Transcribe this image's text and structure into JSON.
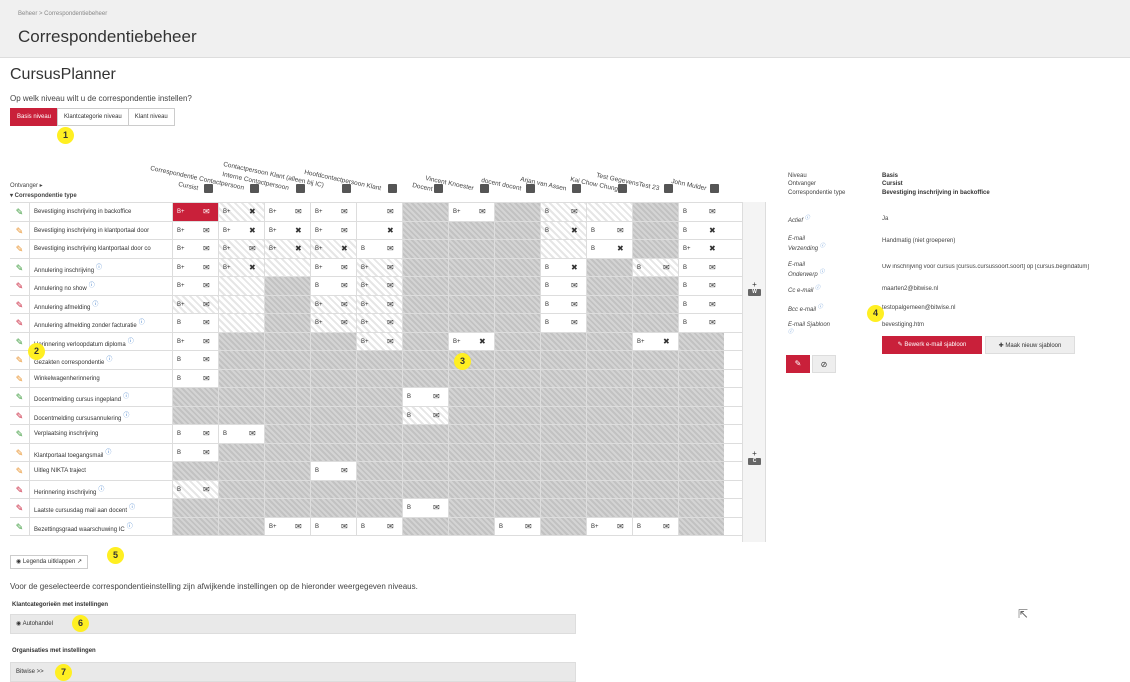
{
  "breadcrumb": "Beheer > Correspondentiebeheer",
  "page_title": "Correspondentiebeheer",
  "app_title": "CursusPlanner",
  "question": "Op welk niveau wilt u de correspondentie instellen?",
  "tabs": [
    "Basis niveau",
    "Klantcategorie niveau",
    "Klant niveau"
  ],
  "columns": [
    "Cursist",
    "Correspondentie Contactpersoon",
    "Interne Contactpersoon",
    "Contactpersoon Klant (alleen bij IC)",
    "Hoofdcontactpersoon Klant",
    "Docent",
    "Vincent Knoester",
    "docent docent",
    "Arjan van Assen",
    "Kai Chow Chung",
    "Test GegevensTest 23",
    "John Mulder"
  ],
  "ontvanger_label": "Ontvanger ▸",
  "correspondentie_type_label": "▾ Correspondentie type",
  "rows": [
    {
      "name": "Bevestiging inschrijving in backoffice",
      "status": "g",
      "info": false
    },
    {
      "name": "Bevestiging inschrijving in klantportaal door",
      "status": "o",
      "info": false
    },
    {
      "name": "Bevestiging inschrijving klantportaal door co",
      "status": "o",
      "info": false
    },
    {
      "name": "Annulering inschrijving",
      "status": "g",
      "info": true
    },
    {
      "name": "Annulering no show",
      "status": "r",
      "info": true
    },
    {
      "name": "Annulering afmelding",
      "status": "r",
      "info": true
    },
    {
      "name": "Annulering afmelding zonder facturatie",
      "status": "r",
      "info": true
    },
    {
      "name": "Herinnering verloopdatum diploma",
      "status": "g",
      "info": true
    },
    {
      "name": "Gezakten correspondentie",
      "status": "o",
      "info": true
    },
    {
      "name": "Winkelwagenherinnering",
      "status": "o",
      "info": false
    },
    {
      "name": "Docentmelding cursus ingepland",
      "status": "g",
      "info": true
    },
    {
      "name": "Docentmelding cursusannulering",
      "status": "r",
      "info": true
    },
    {
      "name": "Verplaatsing inschrijving",
      "status": "g",
      "info": false
    },
    {
      "name": "Klantportaal toegangsmail",
      "status": "o",
      "info": true
    },
    {
      "name": "Uitleg NIKTA traject",
      "status": "o",
      "info": false
    },
    {
      "name": "Herinnering inschrijving",
      "status": "r",
      "info": true
    },
    {
      "name": "Laatste cursusdag mail aan docent",
      "status": "r",
      "info": true
    },
    {
      "name": "Bezettingsgraad waarschuwing IC",
      "status": "g",
      "info": true
    }
  ],
  "cells": [
    [
      [
        "sel",
        "B+",
        "✉"
      ],
      [
        "hat",
        "B+",
        "✖"
      ],
      [
        "on",
        "B+",
        "✉"
      ],
      [
        "on",
        "B+",
        "✉"
      ],
      [
        "on",
        "",
        "✉"
      ],
      [
        "na",
        "",
        ""
      ],
      [
        "on",
        "B+",
        "✉"
      ],
      [
        "na",
        "",
        ""
      ],
      [
        "hat",
        "B",
        "✉"
      ],
      [
        "hat",
        "",
        ""
      ],
      [
        "na",
        "",
        ""
      ],
      [
        "on",
        "B",
        "✉"
      ]
    ],
    [
      [
        "on",
        "B+",
        "✉"
      ],
      [
        "on",
        "B+",
        "✖"
      ],
      [
        "on",
        "B+",
        "✖"
      ],
      [
        "on",
        "B+",
        "✉"
      ],
      [
        "on",
        "",
        "✖"
      ],
      [
        "na",
        "",
        ""
      ],
      [
        "na",
        "",
        ""
      ],
      [
        "na",
        "",
        ""
      ],
      [
        "hat",
        "B",
        "✖"
      ],
      [
        "on",
        "B",
        "✉"
      ],
      [
        "na",
        "",
        ""
      ],
      [
        "on",
        "B",
        "✖"
      ]
    ],
    [
      [
        "on",
        "B+",
        "✉"
      ],
      [
        "hat",
        "B+",
        "✉"
      ],
      [
        "hat",
        "B+",
        "✖"
      ],
      [
        "hat",
        "B+",
        "✖"
      ],
      [
        "on",
        "B",
        "✉"
      ],
      [
        "na",
        "",
        ""
      ],
      [
        "na",
        "",
        ""
      ],
      [
        "na",
        "",
        ""
      ],
      [
        "hat",
        "",
        ""
      ],
      [
        "on",
        "B",
        "✖"
      ],
      [
        "na",
        "",
        ""
      ],
      [
        "on",
        "B+",
        "✖"
      ]
    ],
    [
      [
        "on",
        "B+",
        "✉"
      ],
      [
        "hat",
        "B+",
        "✖"
      ],
      [
        "hat",
        "",
        ""
      ],
      [
        "on",
        "B+",
        "✉"
      ],
      [
        "hat",
        "B+",
        "✉"
      ],
      [
        "na",
        "",
        ""
      ],
      [
        "na",
        "",
        ""
      ],
      [
        "na",
        "",
        ""
      ],
      [
        "on",
        "B",
        "✖"
      ],
      [
        "na",
        "",
        ""
      ],
      [
        "hat",
        "B",
        "✉"
      ],
      [
        "on",
        "B",
        "✉"
      ]
    ],
    [
      [
        "on",
        "B+",
        "✉"
      ],
      [
        "hat",
        "",
        ""
      ],
      [
        "na",
        "",
        ""
      ],
      [
        "on",
        "B",
        "✉"
      ],
      [
        "hat",
        "B+",
        "✉"
      ],
      [
        "na",
        "",
        ""
      ],
      [
        "na",
        "",
        ""
      ],
      [
        "na",
        "",
        ""
      ],
      [
        "on",
        "B",
        "✉"
      ],
      [
        "na",
        "",
        ""
      ],
      [
        "na",
        "",
        ""
      ],
      [
        "on",
        "B",
        "✉"
      ]
    ],
    [
      [
        "hat",
        "B+",
        "✉"
      ],
      [
        "hat",
        "",
        ""
      ],
      [
        "na",
        "",
        ""
      ],
      [
        "hat",
        "B+",
        "✉"
      ],
      [
        "hat",
        "B+",
        "✉"
      ],
      [
        "na",
        "",
        ""
      ],
      [
        "na",
        "",
        ""
      ],
      [
        "na",
        "",
        ""
      ],
      [
        "on",
        "B",
        "✉"
      ],
      [
        "na",
        "",
        ""
      ],
      [
        "na",
        "",
        ""
      ],
      [
        "on",
        "B",
        "✉"
      ]
    ],
    [
      [
        "on",
        "B",
        "✉"
      ],
      [
        "hat",
        "",
        ""
      ],
      [
        "na",
        "",
        ""
      ],
      [
        "hat",
        "B+",
        "✉"
      ],
      [
        "hat",
        "B+",
        "✉"
      ],
      [
        "na",
        "",
        ""
      ],
      [
        "na",
        "",
        ""
      ],
      [
        "na",
        "",
        ""
      ],
      [
        "on",
        "B",
        "✉"
      ],
      [
        "na",
        "",
        ""
      ],
      [
        "na",
        "",
        ""
      ],
      [
        "on",
        "B",
        "✉"
      ]
    ],
    [
      [
        "on",
        "B+",
        "✉"
      ],
      [
        "na",
        "",
        ""
      ],
      [
        "na",
        "",
        ""
      ],
      [
        "na",
        "",
        ""
      ],
      [
        "hat",
        "B+",
        "✉"
      ],
      [
        "na",
        "",
        ""
      ],
      [
        "on",
        "B+",
        "✖"
      ],
      [
        "na",
        "",
        ""
      ],
      [
        "na",
        "",
        ""
      ],
      [
        "na",
        "",
        ""
      ],
      [
        "on",
        "B+",
        "✖"
      ],
      [
        "na",
        "",
        ""
      ]
    ],
    [
      [
        "on",
        "B",
        "✉"
      ],
      [
        "na",
        "",
        ""
      ],
      [
        "na",
        "",
        ""
      ],
      [
        "na",
        "",
        ""
      ],
      [
        "na",
        "",
        ""
      ],
      [
        "na",
        "",
        ""
      ],
      [
        "na",
        "",
        ""
      ],
      [
        "na",
        "",
        ""
      ],
      [
        "na",
        "",
        ""
      ],
      [
        "na",
        "",
        ""
      ],
      [
        "na",
        "",
        ""
      ],
      [
        "na",
        "",
        ""
      ]
    ],
    [
      [
        "on",
        "B",
        "✉"
      ],
      [
        "na",
        "",
        ""
      ],
      [
        "na",
        "",
        ""
      ],
      [
        "na",
        "",
        ""
      ],
      [
        "na",
        "",
        ""
      ],
      [
        "na",
        "",
        ""
      ],
      [
        "na",
        "",
        ""
      ],
      [
        "na",
        "",
        ""
      ],
      [
        "na",
        "",
        ""
      ],
      [
        "na",
        "",
        ""
      ],
      [
        "na",
        "",
        ""
      ],
      [
        "na",
        "",
        ""
      ]
    ],
    [
      [
        "na",
        "",
        ""
      ],
      [
        "na",
        "",
        ""
      ],
      [
        "na",
        "",
        ""
      ],
      [
        "na",
        "",
        ""
      ],
      [
        "na",
        "",
        ""
      ],
      [
        "on",
        "B",
        "✉"
      ],
      [
        "na",
        "",
        ""
      ],
      [
        "na",
        "",
        ""
      ],
      [
        "na",
        "",
        ""
      ],
      [
        "na",
        "",
        ""
      ],
      [
        "na",
        "",
        ""
      ],
      [
        "na",
        "",
        ""
      ]
    ],
    [
      [
        "na",
        "",
        ""
      ],
      [
        "na",
        "",
        ""
      ],
      [
        "na",
        "",
        ""
      ],
      [
        "na",
        "",
        ""
      ],
      [
        "na",
        "",
        ""
      ],
      [
        "hat",
        "B",
        "✉"
      ],
      [
        "na",
        "",
        ""
      ],
      [
        "na",
        "",
        ""
      ],
      [
        "na",
        "",
        ""
      ],
      [
        "na",
        "",
        ""
      ],
      [
        "na",
        "",
        ""
      ],
      [
        "na",
        "",
        ""
      ]
    ],
    [
      [
        "on",
        "B",
        "✉"
      ],
      [
        "on",
        "B",
        "✉"
      ],
      [
        "na",
        "",
        ""
      ],
      [
        "na",
        "",
        ""
      ],
      [
        "na",
        "",
        ""
      ],
      [
        "na",
        "",
        ""
      ],
      [
        "na",
        "",
        ""
      ],
      [
        "na",
        "",
        ""
      ],
      [
        "na",
        "",
        ""
      ],
      [
        "na",
        "",
        ""
      ],
      [
        "na",
        "",
        ""
      ],
      [
        "na",
        "",
        ""
      ]
    ],
    [
      [
        "on",
        "B",
        "✉"
      ],
      [
        "na",
        "",
        ""
      ],
      [
        "na",
        "",
        ""
      ],
      [
        "na",
        "",
        ""
      ],
      [
        "na",
        "",
        ""
      ],
      [
        "na",
        "",
        ""
      ],
      [
        "na",
        "",
        ""
      ],
      [
        "na",
        "",
        ""
      ],
      [
        "na",
        "",
        ""
      ],
      [
        "na",
        "",
        ""
      ],
      [
        "na",
        "",
        ""
      ],
      [
        "na",
        "",
        ""
      ]
    ],
    [
      [
        "na",
        "",
        ""
      ],
      [
        "na",
        "",
        ""
      ],
      [
        "na",
        "",
        ""
      ],
      [
        "on",
        "B",
        "✉"
      ],
      [
        "na",
        "",
        ""
      ],
      [
        "na",
        "",
        ""
      ],
      [
        "na",
        "",
        ""
      ],
      [
        "na",
        "",
        ""
      ],
      [
        "na",
        "",
        ""
      ],
      [
        "na",
        "",
        ""
      ],
      [
        "na",
        "",
        ""
      ],
      [
        "na",
        "",
        ""
      ]
    ],
    [
      [
        "hat",
        "B",
        "✉"
      ],
      [
        "na",
        "",
        ""
      ],
      [
        "na",
        "",
        ""
      ],
      [
        "na",
        "",
        ""
      ],
      [
        "na",
        "",
        ""
      ],
      [
        "na",
        "",
        ""
      ],
      [
        "na",
        "",
        ""
      ],
      [
        "na",
        "",
        ""
      ],
      [
        "na",
        "",
        ""
      ],
      [
        "na",
        "",
        ""
      ],
      [
        "na",
        "",
        ""
      ],
      [
        "na",
        "",
        ""
      ]
    ],
    [
      [
        "na",
        "",
        ""
      ],
      [
        "na",
        "",
        ""
      ],
      [
        "na",
        "",
        ""
      ],
      [
        "na",
        "",
        ""
      ],
      [
        "na",
        "",
        ""
      ],
      [
        "on",
        "B",
        "✉"
      ],
      [
        "na",
        "",
        ""
      ],
      [
        "na",
        "",
        ""
      ],
      [
        "na",
        "",
        ""
      ],
      [
        "na",
        "",
        ""
      ],
      [
        "na",
        "",
        ""
      ],
      [
        "na",
        "",
        ""
      ]
    ],
    [
      [
        "na",
        "",
        ""
      ],
      [
        "na",
        "",
        ""
      ],
      [
        "on",
        "B+",
        "✉"
      ],
      [
        "on",
        "B",
        "✉"
      ],
      [
        "on",
        "B",
        "✉"
      ],
      [
        "na",
        "",
        ""
      ],
      [
        "na",
        "",
        ""
      ],
      [
        "on",
        "B",
        "✉"
      ],
      [
        "na",
        "",
        ""
      ],
      [
        "on",
        "B+",
        "✉"
      ],
      [
        "on",
        "B",
        "✉"
      ],
      [
        "na",
        "",
        ""
      ]
    ]
  ],
  "side_buttons": [
    {
      "plus": "+",
      "tag": "W"
    },
    {
      "plus": "+",
      "tag": "C"
    }
  ],
  "legend_button": "◉ Legenda uitklappen ↗",
  "note": "Voor de geselecteerde correspondentieinstelling zijn afwijkende instellingen op de hieronder weergegeven niveaus.",
  "klantcat_heading": "Klantcategorieën met instellingen",
  "klantcat_item": "◉ Autohandel",
  "org_heading": "Organisaties met instellingen",
  "org_item": "Bitwise >>",
  "markers": [
    "1",
    "2",
    "3",
    "4",
    "5",
    "6",
    "7"
  ],
  "details": {
    "niveau_k": "Niveau",
    "niveau_v": "Basis",
    "ontvanger_k": "Ontvanger",
    "ontvanger_v": "Cursist",
    "type_k": "Correspondentie type",
    "type_v": "Bevestiging inschrijving in backoffice",
    "actief_k": "Actief",
    "actief_v": "Ja",
    "verzending_k": "E-mail Verzending",
    "verzending_v": "Handmatig (niet groeperen)",
    "onderwerp_k": "E-mail Onderwerp",
    "onderwerp_v": "Uw inschrijving voor cursus [cursus.cursussoort.soort] op [cursus.begindatum]",
    "cc_k": "Cc e-mail",
    "cc_v": "maarten2@bitwise.nl",
    "bcc_k": "Bcc e-mail",
    "bcc_v": "testopalgemeen@bitwise.nl",
    "sjabloon_k": "E-mail Sjabloon",
    "sjabloon_v": "bevestiging.htm",
    "edit_template_button": "✎ Bewerk e-mail sjabloon",
    "new_template_button": "✚ Maak nieuw sjabloon",
    "info_icon": "ⓘ"
  },
  "colors": {
    "accent": "#c9203a",
    "marker": "#ffef22"
  }
}
